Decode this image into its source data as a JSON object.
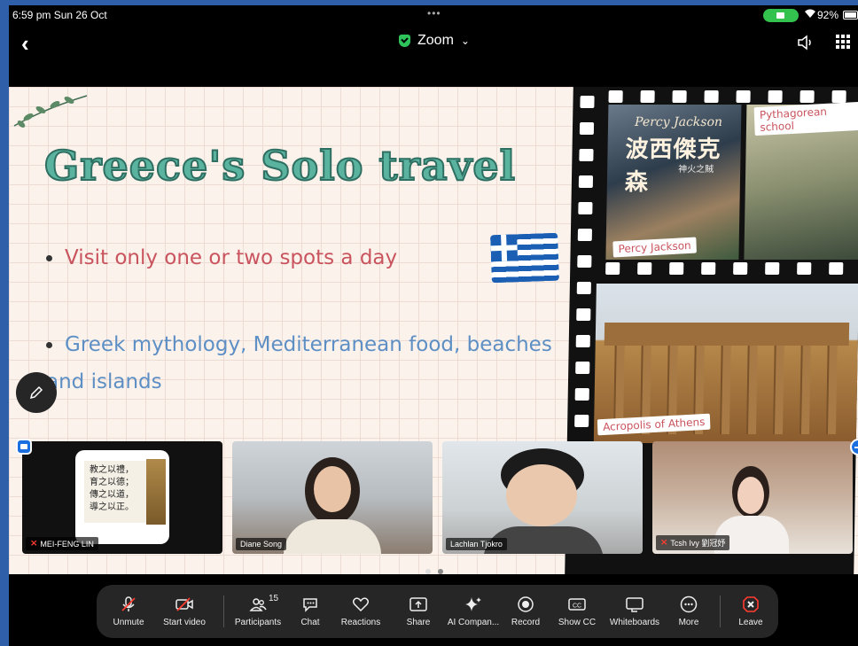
{
  "status_bar": {
    "time": "6:59 pm  Sun 26 Oct",
    "battery": "92%"
  },
  "topbar": {
    "title": "Zoom"
  },
  "slide": {
    "title": "Greece's Solo travel",
    "bullets": [
      "Visit only one or two spots a day",
      "Greek mythology, Mediterranean food, beaches and islands"
    ],
    "percy": {
      "cover_title": "Percy Jackson",
      "cover_cn": "波西傑克森",
      "cover_sub": "神火之賊",
      "tag": "Percy Jackson"
    },
    "pythagorean_tag": "Pythagorean school",
    "acropolis_tag": "Acropolis of Athens"
  },
  "participants": [
    {
      "name": "MEI-FENG LIN",
      "muted": true,
      "slide_lines": [
        "教之以禮，",
        "育之以德；",
        "傳之以道，",
        "導之以正。"
      ]
    },
    {
      "name": "Diane Song",
      "muted": false
    },
    {
      "name": "Lachlan Tjokro",
      "muted": false
    },
    {
      "name": "Tcsh Ivy 劉冠妤",
      "muted": true
    }
  ],
  "toolbar": {
    "participants_count": "15",
    "items": [
      {
        "label": "Unmute",
        "icon": "mic-muted-icon"
      },
      {
        "label": "Start video",
        "icon": "video-off-icon"
      },
      {
        "label": "Participants",
        "icon": "participants-icon"
      },
      {
        "label": "Chat",
        "icon": "chat-icon"
      },
      {
        "label": "Reactions",
        "icon": "heart-icon"
      },
      {
        "label": "Share",
        "icon": "share-icon"
      },
      {
        "label": "AI Compan...",
        "icon": "sparkle-icon"
      },
      {
        "label": "Record",
        "icon": "record-icon"
      },
      {
        "label": "Show CC",
        "icon": "cc-icon"
      },
      {
        "label": "Whiteboards",
        "icon": "whiteboard-icon"
      },
      {
        "label": "More",
        "icon": "more-icon"
      },
      {
        "label": "Leave",
        "icon": "leave-icon"
      }
    ]
  },
  "colors": {
    "accent_green": "#2ec45b",
    "leave_red": "#ff3b30",
    "slide_title": "#5ab39f",
    "bullet_red": "#c9545e",
    "bullet_blue": "#5d8fc4"
  }
}
